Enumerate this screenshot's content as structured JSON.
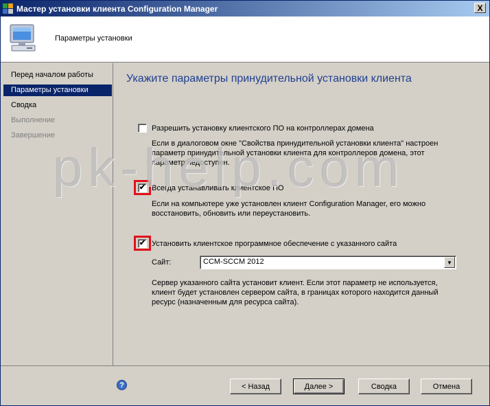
{
  "window": {
    "title": "Мастер установки клиента Configuration Manager",
    "close_glyph": "X"
  },
  "header": {
    "title": "Параметры установки"
  },
  "sidebar": {
    "items": [
      {
        "label": "Перед началом работы",
        "state": "normal"
      },
      {
        "label": "Параметры установки",
        "state": "active"
      },
      {
        "label": "Сводка",
        "state": "normal"
      },
      {
        "label": "Выполнение",
        "state": "disabled"
      },
      {
        "label": "Завершение",
        "state": "disabled"
      }
    ]
  },
  "main": {
    "heading": "Укажите параметры принудительной установки клиента",
    "option_domain_controllers": {
      "label": "Разрешить установку клиентского ПО на контроллерах домена",
      "checked": false,
      "desc_lines": [
        "Если в диалоговом окне \"Свойства принудительной установки клиента\" настроен",
        "параметр принудительной установки клиента для контроллеров домена, этот",
        "параметр недоступен."
      ]
    },
    "option_always_install": {
      "label": "Всегда устанавливать клиентское ПО",
      "checked": true,
      "desc_lines": [
        "Если на компьютере уже установлен клиент Configuration Manager, его можно",
        "восстановить, обновить или переустановить."
      ]
    },
    "option_install_from_site": {
      "label": "Установить клиентское программное обеспечение с указанного сайта",
      "checked": true,
      "site_label": "Сайт:",
      "site_value": "CCM-SCCM 2012",
      "desc_lines": [
        "Сервер указанного сайта установит клиент. Если этот параметр не используется,",
        "клиент будет установлен сервером сайта, в границах которого находится данный",
        "ресурс (назначенным для ресурса сайта)."
      ]
    },
    "check_glyph": "✔",
    "dropdown_glyph": "▼"
  },
  "watermark": "pk-help.com",
  "footer": {
    "help_glyph": "?",
    "back_label": "< Назад",
    "next_label": "Далее >",
    "summary_label": "Сводка",
    "cancel_label": "Отмена"
  },
  "colors": {
    "accent": "#0a246a",
    "heading": "#1f3f8f",
    "highlight_box": "#e3101a"
  }
}
